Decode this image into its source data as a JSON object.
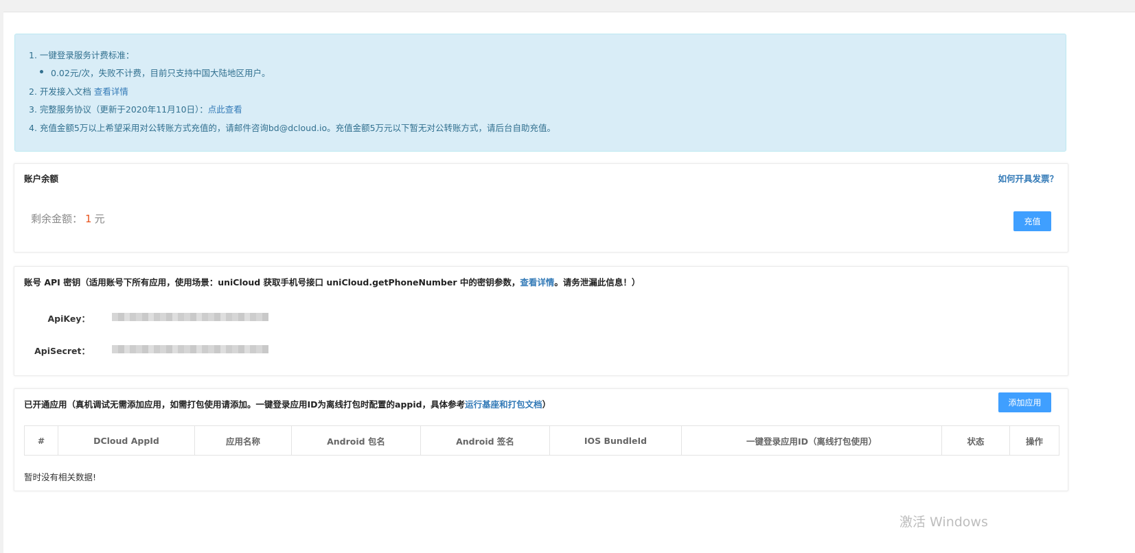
{
  "notice": {
    "line1": "1. 一键登录服务计费标准：",
    "line2": "0.02元/次，失败不计费，目前只支持中国大陆地区用户。",
    "line3_text": "2. 开发接入文档 ",
    "line3_link": "查看详情",
    "line4_text": "3. 完整服务协议（更新于2020年11月10日）：",
    "line4_link": "点此查看",
    "line5": "4. 充值金额5万以上希望采用对公转账方式充值的，请邮件咨询bd@dcloud.io。充值金额5万元以下暂无对公转账方式，请后台自助充值。"
  },
  "balance": {
    "title": "账户余额",
    "invoice_link": "如何开具发票？",
    "label": "剩余金额：",
    "amount": "1",
    "unit": "元",
    "recharge_button": "充值"
  },
  "api": {
    "title_prefix": "账号 API 密钥（适用账号下所有应用，使用场景：uniCloud 获取手机号接口 uniCloud.getPhoneNumber 中的密钥参数，",
    "title_link": "查看详情",
    "title_suffix": "。请务泄漏此信息！）",
    "apikey_label": "ApiKey：",
    "apisecret_label": "ApiSecret："
  },
  "apps": {
    "title_prefix": "已开通应用（真机调试无需添加应用，如需打包使用请添加。一键登录应用ID为离线打包时配置的appid，具体参考",
    "title_link": "运行基座和打包文档",
    "title_suffix": "）",
    "add_button": "添加应用",
    "columns": [
      "#",
      "DCloud AppId",
      "应用名称",
      "Android 包名",
      "Android 签名",
      "IOS BundleId",
      "一键登录应用ID（离线打包使用）",
      "状态",
      "操作"
    ],
    "empty_text": "暂时没有相关数据!"
  },
  "watermark": "激活 Windows"
}
